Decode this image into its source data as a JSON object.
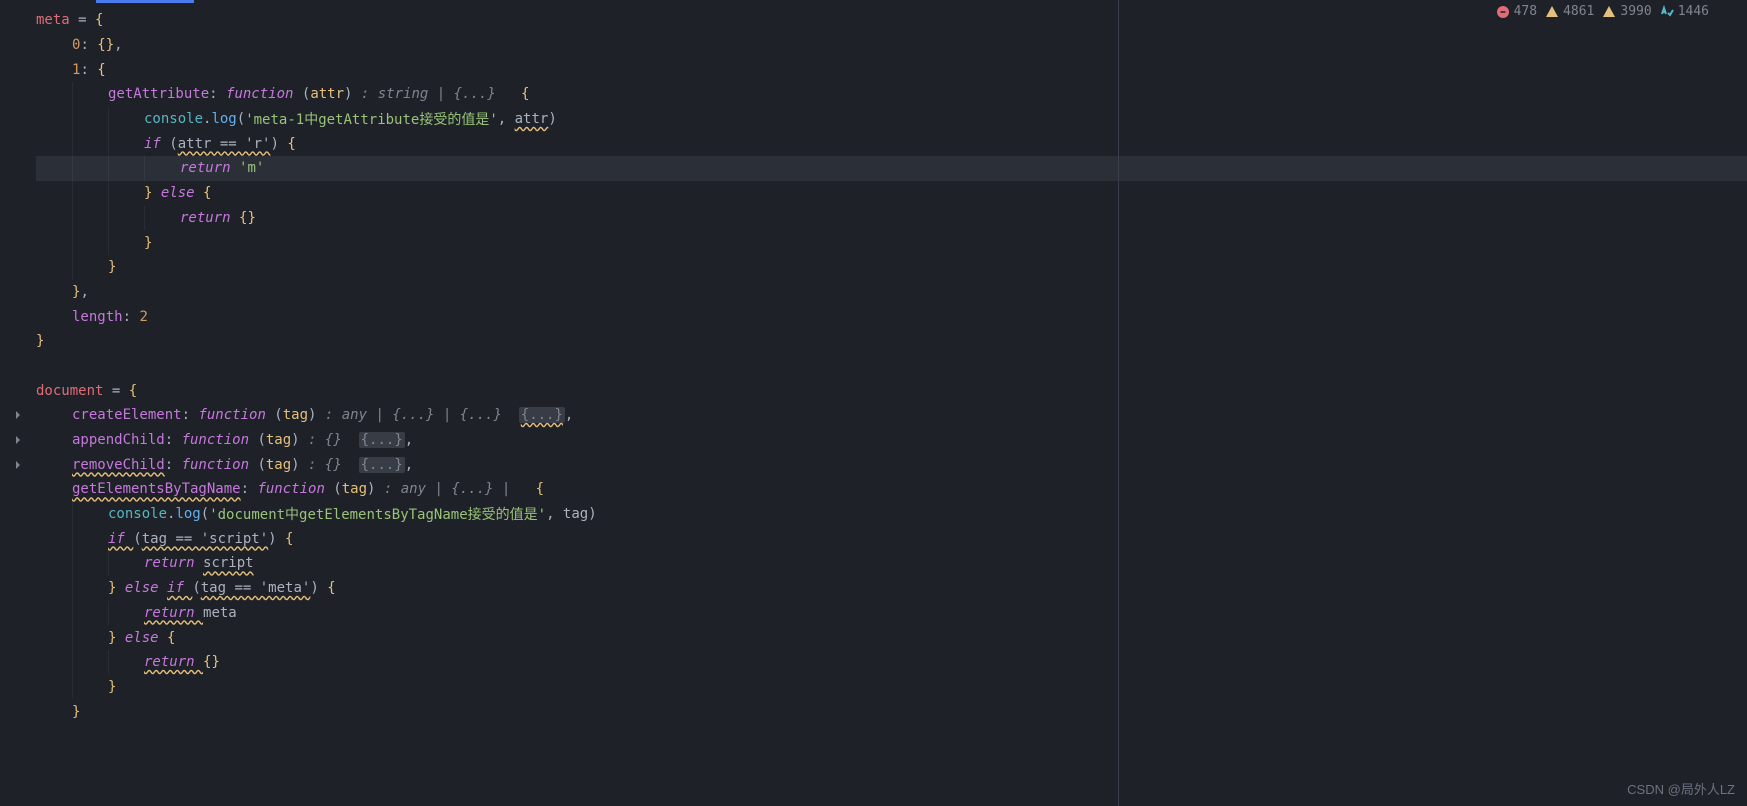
{
  "status_bar": {
    "errors": "478",
    "warnings1": "4861",
    "warnings2": "3990",
    "checks": "1446"
  },
  "watermark": "CSDN @局外人LZ",
  "code": {
    "l1": {
      "decl": "meta",
      "eq": " = ",
      "brace": "{"
    },
    "l2": {
      "key": "0",
      "colon": ": ",
      "val": "{}",
      "comma": ","
    },
    "l3": {
      "key": "1",
      "colon": ": ",
      "brace": "{"
    },
    "l4": {
      "prop": "getAttribute",
      "colon": ": ",
      "kw": "function ",
      "paren": "(",
      "param": "attr",
      "paren2": ") ",
      "type": ": string | {...}",
      "space": "   ",
      "brace": "{"
    },
    "l5": {
      "obj": "console",
      "dot": ".",
      "fn": "log",
      "paren": "(",
      "str": "'meta-1中getAttribute接受的值是'",
      "comma": ", ",
      "ident": "attr",
      "paren2": ")"
    },
    "l6": {
      "kw": "if ",
      "paren": "(",
      "cond": "attr == 'r'",
      "paren2": ") ",
      "brace": "{"
    },
    "l7": {
      "kw": "return ",
      "str": "'m'"
    },
    "l8": {
      "brace": "}",
      "kw": " else ",
      "brace2": "{"
    },
    "l9": {
      "kw": "return ",
      "val": "{}"
    },
    "l10": {
      "brace": "}"
    },
    "l11": {
      "brace": "}"
    },
    "l12": {
      "brace": "}",
      "comma": ","
    },
    "l13": {
      "prop": "length",
      "colon": ": ",
      "num": "2"
    },
    "l14": {
      "brace": "}"
    },
    "l15": {
      "blank": ""
    },
    "l16": {
      "decl": "document",
      "eq": " = ",
      "brace": "{"
    },
    "l17": {
      "prop": "createElement",
      "colon": ": ",
      "kw": "function ",
      "paren": "(",
      "param": "tag",
      "paren2": ") ",
      "type": ": any | {...} | {...}",
      "space": "  ",
      "hint": "{...}",
      "comma": ","
    },
    "l18": {
      "prop": "appendChild",
      "colon": ": ",
      "kw": "function ",
      "paren": "(",
      "param": "tag",
      "paren2": ") ",
      "type": ": {}",
      "space": "  ",
      "hint": "{...}",
      "comma": ","
    },
    "l19": {
      "prop": "removeChild",
      "colon": ": ",
      "kw": "function ",
      "paren": "(",
      "param": "tag",
      "paren2": ") ",
      "type": ": {}",
      "space": "  ",
      "hint": "{...}",
      "comma": ","
    },
    "l20": {
      "prop": "getElementsByTagName",
      "colon": ": ",
      "kw": "function ",
      "paren": "(",
      "param": "tag",
      "paren2": ") ",
      "type": ": any | {...} |",
      "space": "   ",
      "brace": "{"
    },
    "l21": {
      "obj": "console",
      "dot": ".",
      "fn": "log",
      "paren": "(",
      "str": "'document中getElementsByTagName接受的值是'",
      "comma": ", ",
      "ident": "tag",
      "paren2": ")"
    },
    "l22": {
      "kw": "if ",
      "paren": "(",
      "cond": "tag == 'script'",
      "paren2": ") ",
      "brace": "{"
    },
    "l23": {
      "kw": "return ",
      "ident": "script"
    },
    "l24": {
      "brace": "}",
      "kw": " else ",
      "kw2": "if ",
      "paren": "(",
      "cond": "tag == 'meta'",
      "paren2": ") ",
      "brace2": "{"
    },
    "l25": {
      "kw": "return ",
      "ident": "meta"
    },
    "l26": {
      "brace": "}",
      "kw": " else ",
      "brace2": "{"
    },
    "l27": {
      "kw": "return ",
      "val": "{}"
    },
    "l28": {
      "brace": "}"
    },
    "l29": {
      "brace": "}"
    }
  }
}
